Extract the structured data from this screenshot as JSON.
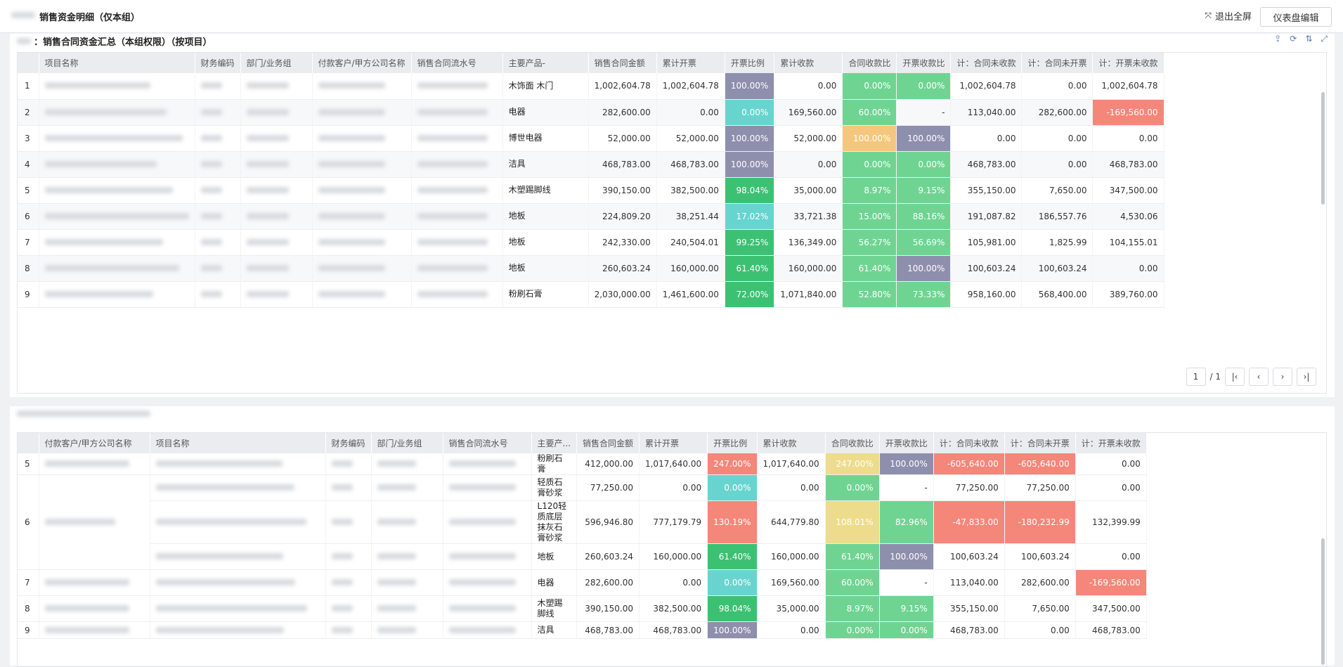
{
  "header": {
    "title": "销售资金明细（仅本组）",
    "exit_fullscreen": "退出全屏",
    "edit_dashboard": "仪表盘编辑"
  },
  "colors": {
    "purple": "#8e8fad",
    "cyan": "#68d4cf",
    "green": "#6fd492",
    "green_dark": "#3cc173",
    "orange": "#f5c77e",
    "yellow": "#eddc8b",
    "red": "#f5867a"
  },
  "panel1": {
    "title": "：销售合同资金汇总（本组权限）（按项目）",
    "tools": [
      "upload-icon",
      "refresh-icon",
      "sort-icon",
      "expand-icon"
    ],
    "columns": [
      "",
      "项目名称",
      "财务编码",
      "部门/业务组",
      "付款客户/甲方公司名称",
      "销售合同流水号",
      "主要产品-",
      "销售合同金额",
      "累计开票",
      "开票比例",
      "累计收款",
      "合同收款比",
      "开票收款比",
      "计：合同未收款",
      "计：合同未开票",
      "计：开票未收款"
    ],
    "rows": [
      {
        "idx": "1",
        "product": "木饰面 木门",
        "amount": "1,002,604.78",
        "invoiced": "1,002,604.78",
        "inv_ratio": "100.00%",
        "inv_c": "purple",
        "received": "0.00",
        "rec_ratio": "0.00%",
        "rec_c": "green",
        "ir_ratio": "0.00%",
        "ir_c": "green",
        "unrec": "1,002,604.78",
        "uninv": "0.00",
        "inv_unrec": "1,002,604.78",
        "inv_unrec_c": ""
      },
      {
        "idx": "2",
        "product": "电器",
        "amount": "282,600.00",
        "invoiced": "0.00",
        "inv_ratio": "0.00%",
        "inv_c": "cyan",
        "received": "169,560.00",
        "rec_ratio": "60.00%",
        "rec_c": "green",
        "ir_ratio": "-",
        "ir_c": "",
        "unrec": "113,040.00",
        "uninv": "282,600.00",
        "inv_unrec": "-169,560.00",
        "inv_unrec_c": "red"
      },
      {
        "idx": "3",
        "product": "博世电器",
        "amount": "52,000.00",
        "invoiced": "52,000.00",
        "inv_ratio": "100.00%",
        "inv_c": "purple",
        "received": "52,000.00",
        "rec_ratio": "100.00%",
        "rec_c": "orange",
        "ir_ratio": "100.00%",
        "ir_c": "purple",
        "unrec": "0.00",
        "uninv": "0.00",
        "inv_unrec": "0.00",
        "inv_unrec_c": ""
      },
      {
        "idx": "4",
        "product": "洁具",
        "amount": "468,783.00",
        "invoiced": "468,783.00",
        "inv_ratio": "100.00%",
        "inv_c": "purple",
        "received": "0.00",
        "rec_ratio": "0.00%",
        "rec_c": "green",
        "ir_ratio": "0.00%",
        "ir_c": "green",
        "unrec": "468,783.00",
        "uninv": "0.00",
        "inv_unrec": "468,783.00",
        "inv_unrec_c": ""
      },
      {
        "idx": "5",
        "product": "木塑踢脚线",
        "amount": "390,150.00",
        "invoiced": "382,500.00",
        "inv_ratio": "98.04%",
        "inv_c": "green_dark",
        "received": "35,000.00",
        "rec_ratio": "8.97%",
        "rec_c": "green",
        "ir_ratio": "9.15%",
        "ir_c": "green",
        "unrec": "355,150.00",
        "uninv": "7,650.00",
        "inv_unrec": "347,500.00",
        "inv_unrec_c": ""
      },
      {
        "idx": "6",
        "product": "地板",
        "amount": "224,809.20",
        "invoiced": "38,251.44",
        "inv_ratio": "17.02%",
        "inv_c": "cyan",
        "received": "33,721.38",
        "rec_ratio": "15.00%",
        "rec_c": "green",
        "ir_ratio": "88.16%",
        "ir_c": "green",
        "unrec": "191,087.82",
        "uninv": "186,557.76",
        "inv_unrec": "4,530.06",
        "inv_unrec_c": ""
      },
      {
        "idx": "7",
        "product": "地板",
        "amount": "242,330.00",
        "invoiced": "240,504.01",
        "inv_ratio": "99.25%",
        "inv_c": "green_dark",
        "received": "136,349.00",
        "rec_ratio": "56.27%",
        "rec_c": "green",
        "ir_ratio": "56.69%",
        "ir_c": "green",
        "unrec": "105,981.00",
        "uninv": "1,825.99",
        "inv_unrec": "104,155.01",
        "inv_unrec_c": ""
      },
      {
        "idx": "8",
        "product": "地板",
        "amount": "260,603.24",
        "invoiced": "160,000.00",
        "inv_ratio": "61.40%",
        "inv_c": "green_dark",
        "received": "160,000.00",
        "rec_ratio": "61.40%",
        "rec_c": "green",
        "ir_ratio": "100.00%",
        "ir_c": "purple",
        "unrec": "100,603.24",
        "uninv": "100,603.24",
        "inv_unrec": "0.00",
        "inv_unrec_c": ""
      },
      {
        "idx": "9",
        "product": "粉刷石膏",
        "amount": "2,030,000.00",
        "invoiced": "1,461,600.00",
        "inv_ratio": "72.00%",
        "inv_c": "green_dark",
        "received": "1,071,840.00",
        "rec_ratio": "52.80%",
        "rec_c": "green",
        "ir_ratio": "73.33%",
        "ir_c": "green",
        "unrec": "958,160.00",
        "uninv": "568,400.00",
        "inv_unrec": "389,760.00",
        "inv_unrec_c": ""
      }
    ],
    "pager": {
      "current": "1",
      "total": "/ 1"
    }
  },
  "panel2": {
    "columns": [
      "",
      "付款客户/甲方公司名称",
      "项目名称",
      "财务编码",
      "部门/业务组",
      "销售合同流水号",
      "主要产...",
      "销售合同金额",
      "累计开票",
      "开票比例",
      "累计收款",
      "合同收款比",
      "开票收款比",
      "计：合同未收款",
      "计：合同未开票",
      "计：开票未收款"
    ],
    "rows": [
      {
        "idx": "5",
        "product": "粉刷石膏",
        "amount": "412,000.00",
        "invoiced": "1,017,640.00",
        "inv_ratio": "247.00%",
        "inv_c": "red",
        "received": "1,017,640.00",
        "rec_ratio": "247.00%",
        "rec_c": "yellow",
        "ir_ratio": "100.00%",
        "ir_c": "purple",
        "unrec": "-605,640.00",
        "unrec_c": "red",
        "uninv": "-605,640.00",
        "uninv_c": "red",
        "inv_unrec": "0.00",
        "inv_unrec_c": ""
      },
      {
        "idx": "6",
        "product": "轻质石膏砂浆",
        "amount": "77,250.00",
        "invoiced": "0.00",
        "inv_ratio": "0.00%",
        "inv_c": "cyan",
        "received": "0.00",
        "rec_ratio": "0.00%",
        "rec_c": "green",
        "ir_ratio": "-",
        "ir_c": "",
        "unrec": "77,250.00",
        "unrec_c": "",
        "uninv": "77,250.00",
        "uninv_c": "",
        "inv_unrec": "0.00",
        "inv_unrec_c": ""
      },
      {
        "idx": "",
        "product": "L120轻质底层抹灰石膏砂浆",
        "amount": "596,946.80",
        "invoiced": "777,179.79",
        "inv_ratio": "130.19%",
        "inv_c": "red",
        "received": "644,779.80",
        "rec_ratio": "108.01%",
        "rec_c": "yellow",
        "ir_ratio": "82.96%",
        "ir_c": "green",
        "unrec": "-47,833.00",
        "unrec_c": "red",
        "uninv": "-180,232.99",
        "uninv_c": "red",
        "inv_unrec": "132,399.99",
        "inv_unrec_c": ""
      },
      {
        "idx": "",
        "product": "地板",
        "amount": "260,603.24",
        "invoiced": "160,000.00",
        "inv_ratio": "61.40%",
        "inv_c": "green_dark",
        "received": "160,000.00",
        "rec_ratio": "61.40%",
        "rec_c": "green",
        "ir_ratio": "100.00%",
        "ir_c": "purple",
        "unrec": "100,603.24",
        "unrec_c": "",
        "uninv": "100,603.24",
        "uninv_c": "",
        "inv_unrec": "0.00",
        "inv_unrec_c": ""
      },
      {
        "idx": "7",
        "product": "电器",
        "amount": "282,600.00",
        "invoiced": "0.00",
        "inv_ratio": "0.00%",
        "inv_c": "cyan",
        "received": "169,560.00",
        "rec_ratio": "60.00%",
        "rec_c": "green",
        "ir_ratio": "-",
        "ir_c": "",
        "unrec": "113,040.00",
        "unrec_c": "",
        "uninv": "282,600.00",
        "uninv_c": "",
        "inv_unrec": "-169,560.00",
        "inv_unrec_c": "red"
      },
      {
        "idx": "8",
        "product": "木塑踢脚线",
        "amount": "390,150.00",
        "invoiced": "382,500.00",
        "inv_ratio": "98.04%",
        "inv_c": "green_dark",
        "received": "35,000.00",
        "rec_ratio": "8.97%",
        "rec_c": "green",
        "ir_ratio": "9.15%",
        "ir_c": "green",
        "unrec": "355,150.00",
        "unrec_c": "",
        "uninv": "7,650.00",
        "uninv_c": "",
        "inv_unrec": "347,500.00",
        "inv_unrec_c": ""
      },
      {
        "idx": "9",
        "product": "洁具",
        "amount": "468,783.00",
        "invoiced": "468,783.00",
        "inv_ratio": "100.00%",
        "inv_c": "purple",
        "received": "0.00",
        "rec_ratio": "0.00%",
        "rec_c": "green",
        "ir_ratio": "0.00%",
        "ir_c": "green",
        "unrec": "468,783.00",
        "unrec_c": "",
        "uninv": "0.00",
        "uninv_c": "",
        "inv_unrec": "468,783.00",
        "inv_unrec_c": ""
      }
    ]
  }
}
